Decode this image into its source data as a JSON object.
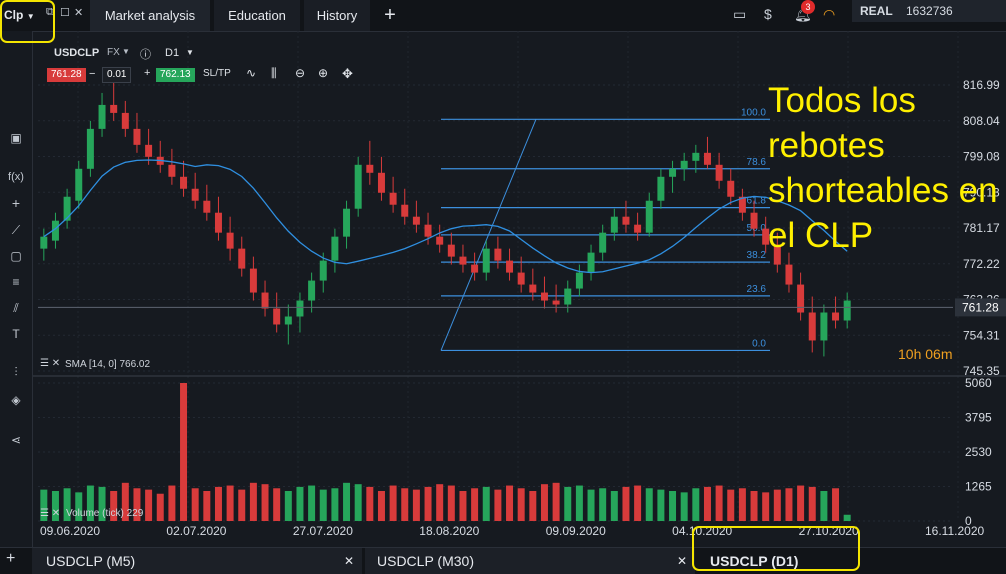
{
  "top": {
    "workspace": "Clp",
    "tabs": [
      "Market analysis",
      "Education",
      "History"
    ],
    "add_tab": "+",
    "notifications": "3",
    "account_type": "REAL",
    "account_number": "1632736"
  },
  "symbol_bar": {
    "symbol": "USDCLP",
    "market": "FX",
    "timeframe": "D1",
    "bid": "761.28",
    "lot": "0.01",
    "ask": "762.13",
    "sltp": "SL/TP"
  },
  "left_tools": [
    "f(x)",
    "+",
    "T"
  ],
  "indicator_label": "SMA [14, 0] 766.02",
  "volume_label": "Volume (tick) 229",
  "timer": "10h 06m",
  "annotation": "Todos los rebotes shorteables en el CLP",
  "bottom_tabs": [
    "USDCLP (M5)",
    "USDCLP (M30)",
    "USDCLP (D1)"
  ],
  "bottom_add": "+",
  "colors": {
    "up": "#26a65b",
    "down": "#d83b3b",
    "sma": "#2f8fe0",
    "fib": "#3c8fdd",
    "annotation": "#fff000"
  },
  "chart_data": {
    "type": "candlestick",
    "symbol": "USDCLP",
    "timeframe": "D1",
    "price_axis": [
      "816.99",
      "808.04",
      "799.08",
      "790.13",
      "781.17",
      "772.22",
      "763.26",
      "754.31",
      "745.35"
    ],
    "last_price": "761.28",
    "volume_axis": [
      "5060",
      "3795",
      "2530",
      "1265",
      "0"
    ],
    "date_labels": [
      "09.06.2020",
      "02.07.2020",
      "27.07.2020",
      "18.08.2020",
      "09.09.2020",
      "04.10.2020",
      "27.10.2020",
      "16.11.2020"
    ],
    "fib_levels": [
      "100.0",
      "78.6",
      "61.8",
      "50.0",
      "38.2",
      "23.6",
      "0.0"
    ],
    "fib_range": [
      750.5,
      808.4
    ],
    "ylim": [
      745.35,
      816.99
    ],
    "volume_ylim": [
      0,
      5060
    ],
    "candles": [
      [
        776,
        781,
        773,
        779
      ],
      [
        778,
        785,
        776,
        783
      ],
      [
        783,
        791,
        781,
        789
      ],
      [
        788,
        798,
        786,
        796
      ],
      [
        796,
        808,
        794,
        806
      ],
      [
        806,
        815,
        804,
        812
      ],
      [
        812,
        818,
        808,
        810
      ],
      [
        810,
        813,
        804,
        806
      ],
      [
        806,
        810,
        800,
        802
      ],
      [
        802,
        806,
        797,
        799
      ],
      [
        799,
        803,
        795,
        797
      ],
      [
        797,
        801,
        792,
        794
      ],
      [
        794,
        798,
        789,
        791
      ],
      [
        791,
        795,
        786,
        788
      ],
      [
        788,
        792,
        783,
        785
      ],
      [
        785,
        789,
        778,
        780
      ],
      [
        780,
        784,
        773,
        776
      ],
      [
        776,
        779,
        769,
        771
      ],
      [
        771,
        774,
        763,
        765
      ],
      [
        765,
        768,
        759,
        761
      ],
      [
        761,
        765,
        755,
        757
      ],
      [
        757,
        762,
        752,
        759
      ],
      [
        759,
        765,
        755,
        763
      ],
      [
        763,
        770,
        760,
        768
      ],
      [
        768,
        775,
        765,
        773
      ],
      [
        773,
        781,
        770,
        779
      ],
      [
        779,
        788,
        776,
        786
      ],
      [
        786,
        799,
        784,
        797
      ],
      [
        797,
        803,
        792,
        795
      ],
      [
        795,
        799,
        788,
        790
      ],
      [
        790,
        794,
        785,
        787
      ],
      [
        787,
        791,
        782,
        784
      ],
      [
        784,
        788,
        780,
        782
      ],
      [
        782,
        785,
        777,
        779
      ],
      [
        779,
        782,
        775,
        777
      ],
      [
        777,
        780,
        772,
        774
      ],
      [
        774,
        777,
        770,
        772
      ],
      [
        772,
        775,
        768,
        770
      ],
      [
        770,
        778,
        768,
        776
      ],
      [
        776,
        779,
        771,
        773
      ],
      [
        773,
        776,
        768,
        770
      ],
      [
        770,
        774,
        765,
        767
      ],
      [
        767,
        771,
        763,
        765
      ],
      [
        765,
        769,
        761,
        763
      ],
      [
        763,
        767,
        760,
        762
      ],
      [
        762,
        768,
        760,
        766
      ],
      [
        766,
        772,
        764,
        770
      ],
      [
        770,
        777,
        768,
        775
      ],
      [
        775,
        782,
        773,
        780
      ],
      [
        780,
        786,
        778,
        784
      ],
      [
        784,
        788,
        780,
        782
      ],
      [
        782,
        785,
        778,
        780
      ],
      [
        780,
        790,
        779,
        788
      ],
      [
        788,
        796,
        786,
        794
      ],
      [
        794,
        798,
        790,
        796
      ],
      [
        796,
        800,
        793,
        798
      ],
      [
        798,
        802,
        795,
        800
      ],
      [
        800,
        804,
        796,
        797
      ],
      [
        797,
        800,
        791,
        793
      ],
      [
        793,
        796,
        787,
        789
      ],
      [
        789,
        791,
        783,
        785
      ],
      [
        785,
        788,
        779,
        781
      ],
      [
        781,
        784,
        775,
        777
      ],
      [
        777,
        780,
        770,
        772
      ],
      [
        772,
        775,
        765,
        767
      ],
      [
        767,
        770,
        758,
        760
      ],
      [
        760,
        764,
        750,
        753
      ],
      [
        753,
        762,
        749,
        760
      ],
      [
        760,
        764,
        756,
        758
      ],
      [
        758,
        765,
        756,
        763
      ]
    ],
    "volumes": [
      1150,
      1100,
      1200,
      1050,
      1300,
      1250,
      1100,
      1400,
      1200,
      1150,
      1000,
      1300,
      5060,
      1200,
      1100,
      1250,
      1300,
      1150,
      1400,
      1350,
      1200,
      1100,
      1250,
      1300,
      1150,
      1200,
      1400,
      1350,
      1250,
      1100,
      1300,
      1200,
      1150,
      1250,
      1350,
      1300,
      1100,
      1200,
      1250,
      1150,
      1300,
      1200,
      1100,
      1350,
      1400,
      1250,
      1300,
      1150,
      1200,
      1100,
      1250,
      1300,
      1200,
      1150,
      1100,
      1050,
      1200,
      1250,
      1300,
      1150,
      1200,
      1100,
      1050,
      1150,
      1200,
      1300,
      1250,
      1100,
      1200,
      229
    ]
  }
}
